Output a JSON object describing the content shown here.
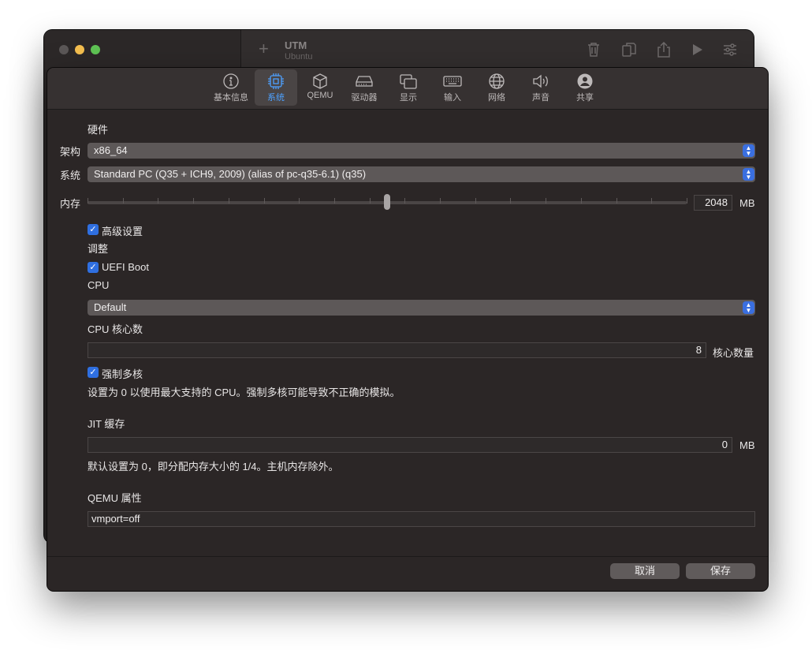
{
  "background_window": {
    "title": "UTM",
    "subtitle": "Ubuntu",
    "plus_icon": "+",
    "toolbar_icons": [
      "trash-icon",
      "clone-icon",
      "share-icon",
      "play-icon",
      "settings-sliders-icon"
    ]
  },
  "tabs": [
    {
      "label": "基本信息",
      "icon": "info-icon"
    },
    {
      "label": "系统",
      "icon": "cpu-chip-icon",
      "active": true
    },
    {
      "label": "QEMU",
      "icon": "cube-icon"
    },
    {
      "label": "驱动器",
      "icon": "drive-icon"
    },
    {
      "label": "显示",
      "icon": "display-icon"
    },
    {
      "label": "输入",
      "icon": "keyboard-icon"
    },
    {
      "label": "网络",
      "icon": "globe-icon"
    },
    {
      "label": "声音",
      "icon": "speaker-icon"
    },
    {
      "label": "共享",
      "icon": "person-icon"
    }
  ],
  "hardware": {
    "heading": "硬件",
    "arch_label": "架构",
    "arch_value": "x86_64",
    "system_label": "系统",
    "system_value": "Standard PC (Q35 + ICH9, 2009) (alias of pc-q35-6.1) (q35)",
    "memory_label": "内存",
    "memory_value": "2048",
    "memory_unit": "MB",
    "memory_slider_fraction": 0.5
  },
  "advanced": {
    "checkbox_label": "高级设置",
    "checked": true
  },
  "tuning": {
    "heading": "调整",
    "uefi_label": "UEFI Boot",
    "uefi_checked": true,
    "cpu_label": "CPU",
    "cpu_value": "Default",
    "cpu_cores_label": "CPU 核心数",
    "cpu_cores_value": "8",
    "cpu_cores_unit": "核心数量",
    "force_multicore_label": "强制多核",
    "force_multicore_checked": true,
    "cores_hint": "设置为 0 以使用最大支持的 CPU。强制多核可能导致不正确的模拟。",
    "jit_label": "JIT 缓存",
    "jit_value": "0",
    "jit_unit": "MB",
    "jit_hint": "默认设置为 0，即分配内存大小的 1/4。主机内存除外。",
    "qemu_props_label": "QEMU 属性",
    "qemu_props_value": "vmport=off"
  },
  "footer": {
    "cancel_label": "取消",
    "save_label": "保存"
  },
  "colors": {
    "accent": "#4da1ff",
    "checkbox": "#2f6fe0",
    "traffic_min": "#f5bf4f",
    "traffic_max": "#5fc454"
  }
}
